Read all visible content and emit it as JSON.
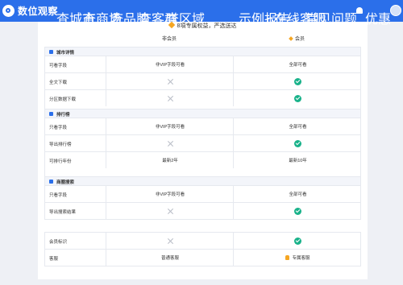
{
  "topbar": {
    "logo_text": "数位观察",
    "nav": [
      "查城市",
      "查商场",
      "查品牌",
      "查客群",
      "查区域"
    ],
    "report_label": "示例报告",
    "online_service": "在线客服",
    "faq": "常见问题",
    "vip": "优惠"
  },
  "banner": {
    "text": "8項专属权益，严选送达"
  },
  "columns": {
    "free": "非会员",
    "vip": "会员"
  },
  "sections": [
    {
      "title": "城市详情"
    },
    {
      "title": "排行榜"
    },
    {
      "title": "商圈搜索"
    }
  ],
  "rows": [
    {
      "label": "可看字段",
      "free": "非VIP字段可看",
      "vip": "全部可看"
    },
    {
      "label": "全文下载",
      "free": "x",
      "vip": "check"
    },
    {
      "label": "分区数据下载",
      "free": "x",
      "vip": "check"
    },
    {
      "label": "只看字段",
      "free": "非VIP字段可看",
      "vip": "全部可看"
    },
    {
      "label": "导出排行榜",
      "free": "x",
      "vip": "check"
    },
    {
      "label": "可排行年份",
      "free": "最新2年",
      "vip": "最新10年"
    },
    {
      "label": "只看字段",
      "free": "非VIP字段可看",
      "vip": "全部可看"
    },
    {
      "label": "导出搜索结果",
      "free": "x",
      "vip": "check"
    },
    {
      "label": "会员标识",
      "free": "x",
      "vip": "check"
    },
    {
      "label": "客服",
      "free": "普通客服",
      "vip": "专属客服"
    }
  ],
  "colors": {
    "accent": "#2b6fea",
    "check": "#19b28a",
    "gold": "#f5a623"
  }
}
